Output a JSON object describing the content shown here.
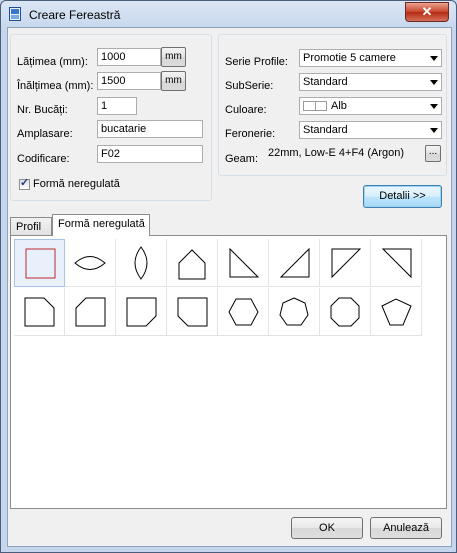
{
  "window": {
    "title": "Creare Fereastră",
    "close_glyph": "✕"
  },
  "left_group": {
    "width_label": "Lățimea (mm):",
    "width_value": "1000",
    "width_unit_button": "mm",
    "height_label": "Înălțimea (mm):",
    "height_value": "1500",
    "height_unit_button": "mm",
    "count_label": "Nr. Bucăți:",
    "count_value": "1",
    "location_label": "Amplasare:",
    "location_value": "bucatarie",
    "code_label": "Codificare:",
    "code_value": "F02",
    "irregular_checkbox_label": "Formă neregulată",
    "irregular_checked": true
  },
  "right_group": {
    "profile_series_label": "Serie Profile:",
    "profile_series_value": "Promotie 5 camere",
    "subseries_label": "SubSerie:",
    "subseries_value": "Standard",
    "color_label": "Culoare:",
    "color_value": "Alb",
    "hardware_label": "Feronerie:",
    "hardware_value": "Standard",
    "glass_label": "Geam:",
    "glass_value": "22mm, Low-E 4+F4 (Argon)",
    "glass_browse_button": "..."
  },
  "details_button": "Detalii >>",
  "tabs": [
    {
      "label": "Profil",
      "active": false
    },
    {
      "label": "Formă neregulată",
      "active": true
    }
  ],
  "shapes": [
    {
      "icon": "square-shape-icon",
      "selected": true
    },
    {
      "icon": "lens-horizontal-shape-icon",
      "selected": false
    },
    {
      "icon": "lens-vertical-shape-icon",
      "selected": false
    },
    {
      "icon": "pentagon-house-shape-icon",
      "selected": false
    },
    {
      "icon": "right-triangle-left-shape-icon",
      "selected": false
    },
    {
      "icon": "right-triangle-right-shape-icon",
      "selected": false
    },
    {
      "icon": "triangle-top-left-shape-icon",
      "selected": false
    },
    {
      "icon": "triangle-top-right-shape-icon",
      "selected": false
    },
    {
      "icon": "cut-corner-top-right-shape-icon",
      "selected": false
    },
    {
      "icon": "cut-corner-top-left-shape-icon",
      "selected": false
    },
    {
      "icon": "cut-corner-bottom-right-shape-icon",
      "selected": false
    },
    {
      "icon": "cut-corner-bottom-left-shape-icon",
      "selected": false
    },
    {
      "icon": "hexagon-shape-icon",
      "selected": false
    },
    {
      "icon": "heptagon-shape-icon",
      "selected": false
    },
    {
      "icon": "octagon-shape-icon",
      "selected": false
    },
    {
      "icon": "pentagon-inverted-shape-icon",
      "selected": false
    }
  ],
  "footer": {
    "ok_label": "OK",
    "cancel_label": "Anulează"
  },
  "colors": {
    "selected_shape_border": "#c0282d",
    "title_bar": "#c5d6ec",
    "close_button": "#c7432b"
  }
}
